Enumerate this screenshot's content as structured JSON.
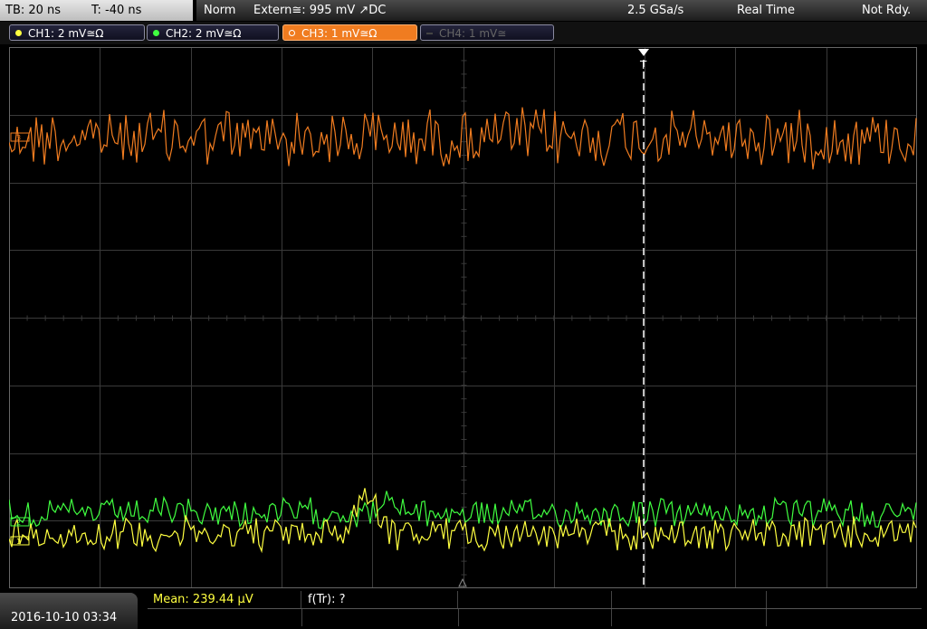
{
  "top": {
    "timebase": "TB: 20 ns",
    "trigger_time": "T: -40 ns",
    "mode": "Norm",
    "trigger_source": "Extern≅: 995 mV ↗DC",
    "sample_rate": "2.5 GSa/s",
    "acq_mode": "Real Time",
    "status": "Not Rdy."
  },
  "channels": [
    {
      "label": "CH1: 2 mV≅Ω",
      "color": "#ffff40",
      "active": false,
      "enabled": true
    },
    {
      "label": "CH2: 2 mV≅Ω",
      "color": "#40ff40",
      "active": false,
      "enabled": true
    },
    {
      "label": "CH3: 1 mV≅Ω",
      "color": "#f07c20",
      "active": true,
      "enabled": true
    },
    {
      "label": "CH4: 1 mV≅",
      "color": "#555555",
      "active": false,
      "enabled": false
    }
  ],
  "screen": {
    "trigger_marker": "T",
    "ch_markers": [
      "1",
      "2",
      "3"
    ]
  },
  "bottom": {
    "datetime": "2016-10-10 03:34",
    "measurement_1": "Mean: 239.44 μV",
    "measurement_2": "f(Tr): ?"
  },
  "colors": {
    "ch1": "#ffff40",
    "ch2": "#40ff40",
    "ch3": "#f07c20",
    "grid": "#3a3a3a"
  }
}
